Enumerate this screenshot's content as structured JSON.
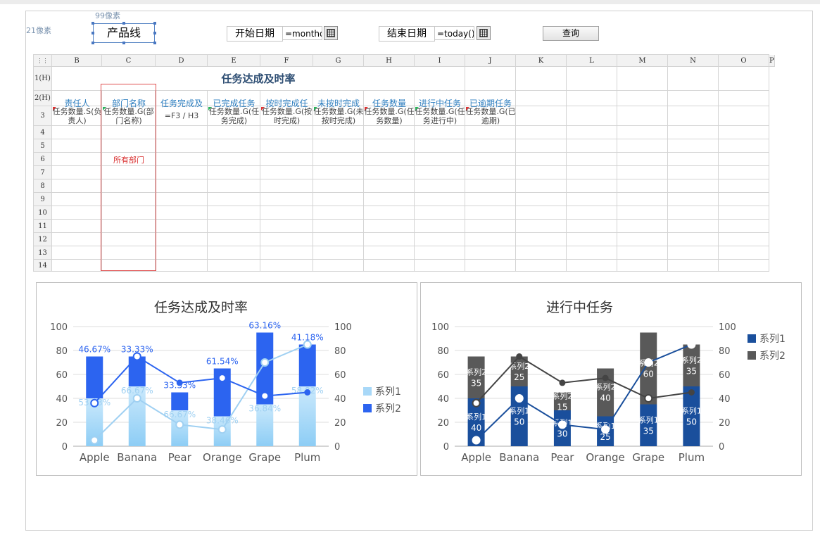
{
  "toolbar": {
    "px_label_top": "99像素",
    "px_label_left": "21像素",
    "product_line_label": "产品线",
    "start_date_label": "开始日期",
    "start_date_value": "=monthdelta",
    "end_date_label": "结束日期",
    "end_date_value": "=today()",
    "query_button": "查询"
  },
  "sheet": {
    "columns": [
      "B",
      "C",
      "D",
      "E",
      "F",
      "G",
      "H",
      "I",
      "J",
      "K",
      "L",
      "M",
      "N",
      "O",
      "P"
    ],
    "rows": [
      "1(H)",
      "2(H)",
      "3",
      "4",
      "5",
      "6",
      "7",
      "8",
      "9",
      "10",
      "11",
      "12",
      "13",
      "14"
    ],
    "title": "任务达成及时率",
    "headers": [
      "责任人",
      "部门名称",
      "任务完成及",
      "已完成任务",
      "按时完成任",
      "未按时完成",
      "任务数量",
      "进行中任务",
      "已逾期任务"
    ],
    "row3": [
      "任务数量.S(负责人)",
      "任务数量.G(部门名称)",
      "=F3 / H3",
      "任务数量.G(任务完成)",
      "任务数量.G(按时完成)",
      "任务数量.G(未按时完成)",
      "任务数量.G(任务数量)",
      "任务数量.G(任务进行中)",
      "任务数量.G(已逾期)"
    ],
    "all_depts": "所有部门"
  },
  "chart1": {
    "title": "任务达成及时率",
    "legend": [
      "系列1",
      "系列2"
    ],
    "colors": {
      "s1": "#a8d8f8",
      "s2": "#2c64f0",
      "line1": "#9fd0f2",
      "line2": "#2c64f0"
    },
    "ytick_labels": [
      "0",
      "20",
      "40",
      "60",
      "80",
      "100"
    ],
    "chart_data": {
      "type": "bar",
      "stacked": true,
      "categories": [
        "Apple",
        "Banana",
        "Pear",
        "Orange",
        "Grape",
        "Plum"
      ],
      "ylim": [
        0,
        100
      ],
      "series": [
        {
          "name": "系列1",
          "values": [
            40,
            50,
            30,
            25,
            35,
            50
          ],
          "labels": [
            "53.33%",
            "66.67%",
            "66.67%",
            "38.46%",
            "36.84%",
            "58.82%"
          ]
        },
        {
          "name": "系列2",
          "values": [
            35,
            25,
            15,
            40,
            60,
            35
          ],
          "labels": [
            "46.67%",
            "33.33%",
            "33.33%",
            "61.54%",
            "63.16%",
            "41.18%"
          ]
        }
      ],
      "lines": [
        {
          "values": [
            5,
            40,
            18,
            14,
            70,
            85
          ]
        },
        {
          "values": [
            36,
            75,
            53,
            57,
            42,
            45
          ]
        }
      ]
    }
  },
  "chart2": {
    "title": "进行中任务",
    "legend": [
      "系列1",
      "系列2"
    ],
    "colors": {
      "s1": "#1a4f9c",
      "s2": "#595959",
      "line1": "#1a4f9c",
      "line2": "#444444"
    },
    "ytick_labels": [
      "0",
      "20",
      "40",
      "60",
      "80",
      "100"
    ],
    "chart_data": {
      "type": "bar",
      "stacked": true,
      "categories": [
        "Apple",
        "Banana",
        "Pear",
        "Orange",
        "Grape",
        "Plum"
      ],
      "ylim": [
        0,
        100
      ],
      "series": [
        {
          "name": "系列1",
          "values": [
            40,
            50,
            30,
            25,
            35,
            50
          ]
        },
        {
          "name": "系列2",
          "values": [
            35,
            25,
            15,
            40,
            60,
            35
          ]
        }
      ],
      "lines": [
        {
          "values": [
            5,
            40,
            18,
            14,
            70,
            85
          ]
        },
        {
          "values": [
            36,
            75,
            53,
            57,
            40,
            45
          ]
        }
      ]
    }
  }
}
